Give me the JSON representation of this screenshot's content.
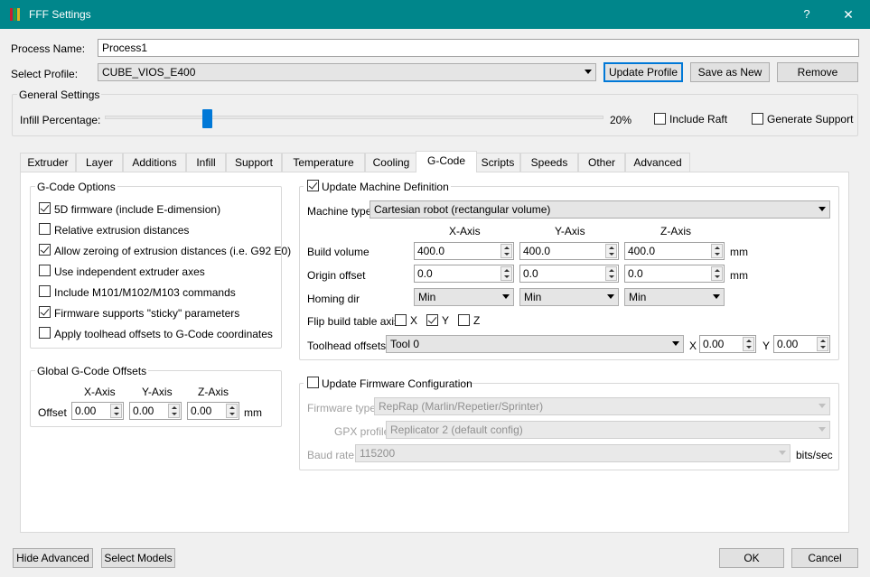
{
  "window": {
    "title": "FFF Settings",
    "help_glyph": "?",
    "close_glyph": "✕"
  },
  "process_name": {
    "label": "Process Name:",
    "value": "Process1"
  },
  "select_profile": {
    "label": "Select Profile:",
    "value": "CUBE_VIOS_E400"
  },
  "buttons": {
    "update_profile": "Update Profile",
    "save_as_new": "Save as New",
    "remove": "Remove",
    "hide_advanced": "Hide Advanced",
    "select_models": "Select Models",
    "ok": "OK",
    "cancel": "Cancel"
  },
  "general": {
    "title": "General Settings",
    "infill_label": "Infill Percentage:",
    "infill_value": "20%",
    "infill_fraction": 0.2,
    "include_raft": {
      "label": "Include Raft",
      "checked": false
    },
    "generate_support": {
      "label": "Generate Support",
      "checked": false
    }
  },
  "tabs": [
    "Extruder",
    "Layer",
    "Additions",
    "Infill",
    "Support",
    "Temperature",
    "Cooling",
    "G-Code",
    "Scripts",
    "Speeds",
    "Other",
    "Advanced"
  ],
  "active_tab": "G-Code",
  "gcode_options": {
    "title": "G-Code Options",
    "items": [
      {
        "label": "5D firmware (include E-dimension)",
        "checked": true
      },
      {
        "label": "Relative extrusion distances",
        "checked": false
      },
      {
        "label": "Allow zeroing of extrusion distances (i.e. G92 E0)",
        "checked": true
      },
      {
        "label": "Use independent extruder axes",
        "checked": false
      },
      {
        "label": "Include M101/M102/M103 commands",
        "checked": false
      },
      {
        "label": "Firmware supports \"sticky\" parameters",
        "checked": true
      },
      {
        "label": "Apply toolhead offsets to G-Code coordinates",
        "checked": false
      }
    ]
  },
  "global_offsets": {
    "title": "Global G-Code Offsets",
    "x_header": "X-Axis",
    "y_header": "Y-Axis",
    "z_header": "Z-Axis",
    "offset_label": "Offset",
    "x": "0.00",
    "y": "0.00",
    "z": "0.00",
    "unit": "mm"
  },
  "machine": {
    "update_label": "Update Machine Definition",
    "update_checked": true,
    "machine_type_label": "Machine type",
    "machine_type": "Cartesian robot (rectangular volume)",
    "x_header": "X-Axis",
    "y_header": "Y-Axis",
    "z_header": "Z-Axis",
    "build_volume_label": "Build volume",
    "build_volume": [
      "400.0",
      "400.0",
      "400.0"
    ],
    "origin_offset_label": "Origin offset",
    "origin_offset": [
      "0.0",
      "0.0",
      "0.0"
    ],
    "unit": "mm",
    "homing_label": "Homing dir",
    "homing": [
      "Min",
      "Min",
      "Min"
    ],
    "flip_label": "Flip build table axis",
    "flip": [
      {
        "label": "X",
        "checked": false
      },
      {
        "label": "Y",
        "checked": true
      },
      {
        "label": "Z",
        "checked": false
      }
    ],
    "toolhead_label": "Toolhead offsets",
    "toolhead": "Tool 0",
    "tool_x_label": "X",
    "tool_x": "0.00",
    "tool_y_label": "Y",
    "tool_y": "0.00"
  },
  "firmware": {
    "update_label": "Update Firmware Configuration",
    "update_checked": false,
    "type_label": "Firmware type",
    "type": "RepRap (Marlin/Repetier/Sprinter)",
    "gpx_label": "GPX profile",
    "gpx": "Replicator 2 (default config)",
    "baud_label": "Baud rate",
    "baud": "115200",
    "baud_unit": "bits/sec"
  },
  "colors": {
    "titlebar": "#00868b",
    "accent": "#0078d7"
  }
}
